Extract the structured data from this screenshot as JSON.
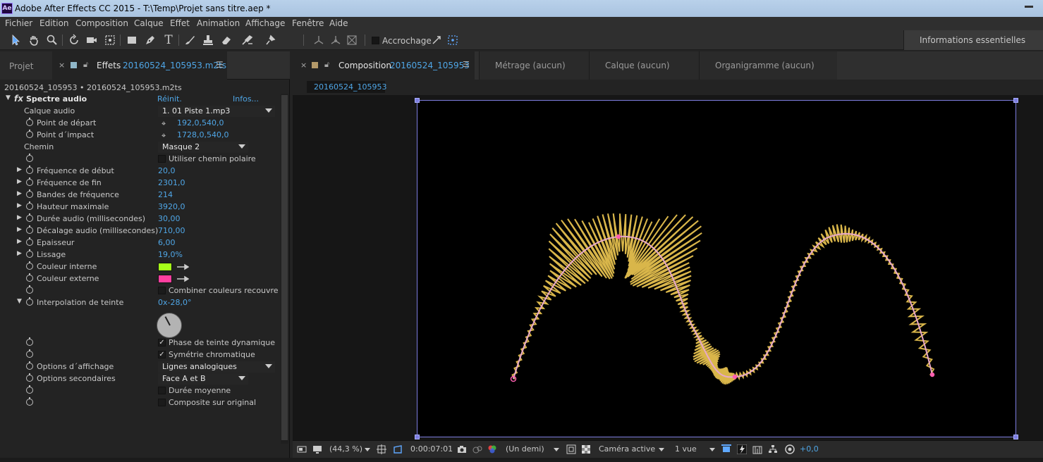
{
  "window": {
    "app_icon": "Ae",
    "title": "Adobe After Effects CC 2015 - T:\\Temp\\Projet sans titre.aep *"
  },
  "menu": [
    "Fichier",
    "Edition",
    "Composition",
    "Calque",
    "Effet",
    "Animation",
    "Affichage",
    "Fenêtre",
    "Aide"
  ],
  "toolbar": {
    "tools": [
      "selection-tool",
      "hand-tool",
      "zoom-tool",
      "rotate-tool",
      "camera-tool",
      "pan-behind-tool",
      "rectangle-tool",
      "pen-tool",
      "type-tool",
      "brush-tool",
      "clone-stamp-tool",
      "eraser-tool",
      "roto-brush-tool",
      "puppet-pin-tool",
      "axis-local",
      "axis-world",
      "axis-view"
    ],
    "snapping_label": "Accrochage",
    "workspace": "Informations essentielles"
  },
  "left_panel": {
    "tab_project": "Projet",
    "tab_effects_label": "Effets",
    "tab_effects_file": "20160524_105953.m2ts",
    "breadcrumb": "20160524_105953 • 20160524_105953.m2ts",
    "effect": {
      "fx": "fx",
      "name": "Spectre audio",
      "reset": "Réinit.",
      "about": "Infos..."
    },
    "props": {
      "audio_layer": {
        "name": "Calque audio",
        "value": "1. 01 Piste 1.mp3"
      },
      "start_point": {
        "name": "Point de départ",
        "value": "192,0,540,0"
      },
      "end_point": {
        "name": "Point d´impact",
        "value": "1728,0,540,0"
      },
      "path": {
        "name": "Chemin",
        "value": "Masque 2"
      },
      "polar_path": {
        "name": "Utiliser chemin polaire",
        "checked": false
      },
      "start_freq": {
        "name": "Fréquence de début",
        "value": "20,0"
      },
      "end_freq": {
        "name": "Fréquence de fin",
        "value": "2301,0"
      },
      "freq_bands": {
        "name": "Bandes de fréquence",
        "value": "214"
      },
      "max_height": {
        "name": "Hauteur maximale",
        "value": "3920,0"
      },
      "audio_duration": {
        "name": "Durée audio (millisecondes)",
        "value": "30,00"
      },
      "audio_offset": {
        "name": "Décalage audio (millisecondes)",
        "value": "710,00"
      },
      "thickness": {
        "name": "Epaisseur",
        "value": "6,00"
      },
      "softness": {
        "name": "Lissage",
        "value": "19,0%"
      },
      "inside_color": {
        "name": "Couleur interne",
        "color": "#a6ff1a"
      },
      "outside_color": {
        "name": "Couleur externe",
        "color": "#ff3fa0"
      },
      "blend_overlap": {
        "name": "Combiner couleurs recouvre",
        "checked": false
      },
      "hue_interp": {
        "name": "Interpolation de teinte",
        "value": "0x-28,0°"
      },
      "dynamic_hue": {
        "name": "Phase de teinte dynamique",
        "checked": true
      },
      "color_symmetry": {
        "name": "Symétrie chromatique",
        "checked": true
      },
      "display_options": {
        "name": "Options d´affichage",
        "value": "Lignes analogiques"
      },
      "side_options": {
        "name": "Options secondaires",
        "value": "Face A et B"
      },
      "duration_avg": {
        "name": "Durée moyenne",
        "checked": false
      },
      "composite": {
        "name": "Composite sur original",
        "checked": false
      }
    }
  },
  "right_panel": {
    "tab_comp_label": "Composition",
    "tab_comp_name": "20160524_105953",
    "tab_footage": "Métrage  (aucun)",
    "tab_layer": "Calque  (aucun)",
    "tab_flowchart": "Organigramme  (aucun)",
    "comp_breadcrumb": "20160524_105953",
    "status": {
      "zoom": "(44,3 %)",
      "timecode": "0:00:07:01",
      "resolution": "(Un demi)",
      "camera": "Caméra active",
      "views": "1 vue",
      "exposure": "+0,0"
    }
  },
  "colors": {
    "accent_blue": "#4fa6e6",
    "panel_bg": "#232323",
    "comp_border": "#7d7de0",
    "wave_stroke": "#e7a8c8",
    "spectrum_lines": "#d9b64a"
  }
}
